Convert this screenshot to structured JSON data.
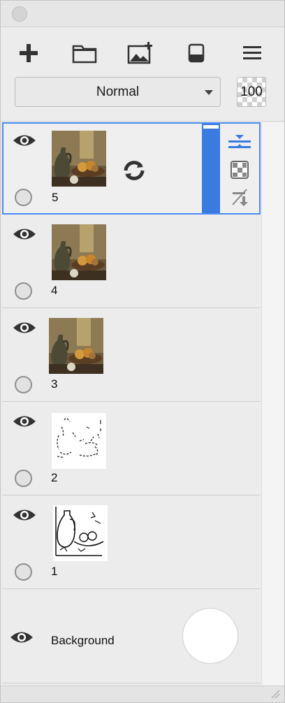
{
  "toolbar": {
    "tools": [
      {
        "name": "add-layer",
        "icon": "plus-icon"
      },
      {
        "name": "add-group",
        "icon": "folder-icon"
      },
      {
        "name": "add-image",
        "icon": "image-plus-icon"
      },
      {
        "name": "eraser",
        "icon": "eraser-icon"
      },
      {
        "name": "menu",
        "icon": "hamburger-icon"
      }
    ],
    "blend_mode": "Normal",
    "opacity": "100"
  },
  "layers": [
    {
      "label": "5",
      "thumbnail": "still-life-color",
      "active": true
    },
    {
      "label": "4",
      "thumbnail": "still-life-color",
      "active": false
    },
    {
      "label": "3",
      "thumbnail": "still-life-color",
      "active": false
    },
    {
      "label": "2",
      "thumbnail": "line-sketch-sparse",
      "active": false
    },
    {
      "label": "1",
      "thumbnail": "line-sketch-outline",
      "active": false
    }
  ],
  "background_layer": {
    "label": "Background"
  },
  "active_layer_tools": [
    {
      "icon": "fit-vertical-icon"
    },
    {
      "icon": "transparency-icon"
    },
    {
      "icon": "merge-down-icon"
    }
  ],
  "colors": {
    "accent": "#3b7ae0",
    "selection_border": "#4a8bf5"
  }
}
